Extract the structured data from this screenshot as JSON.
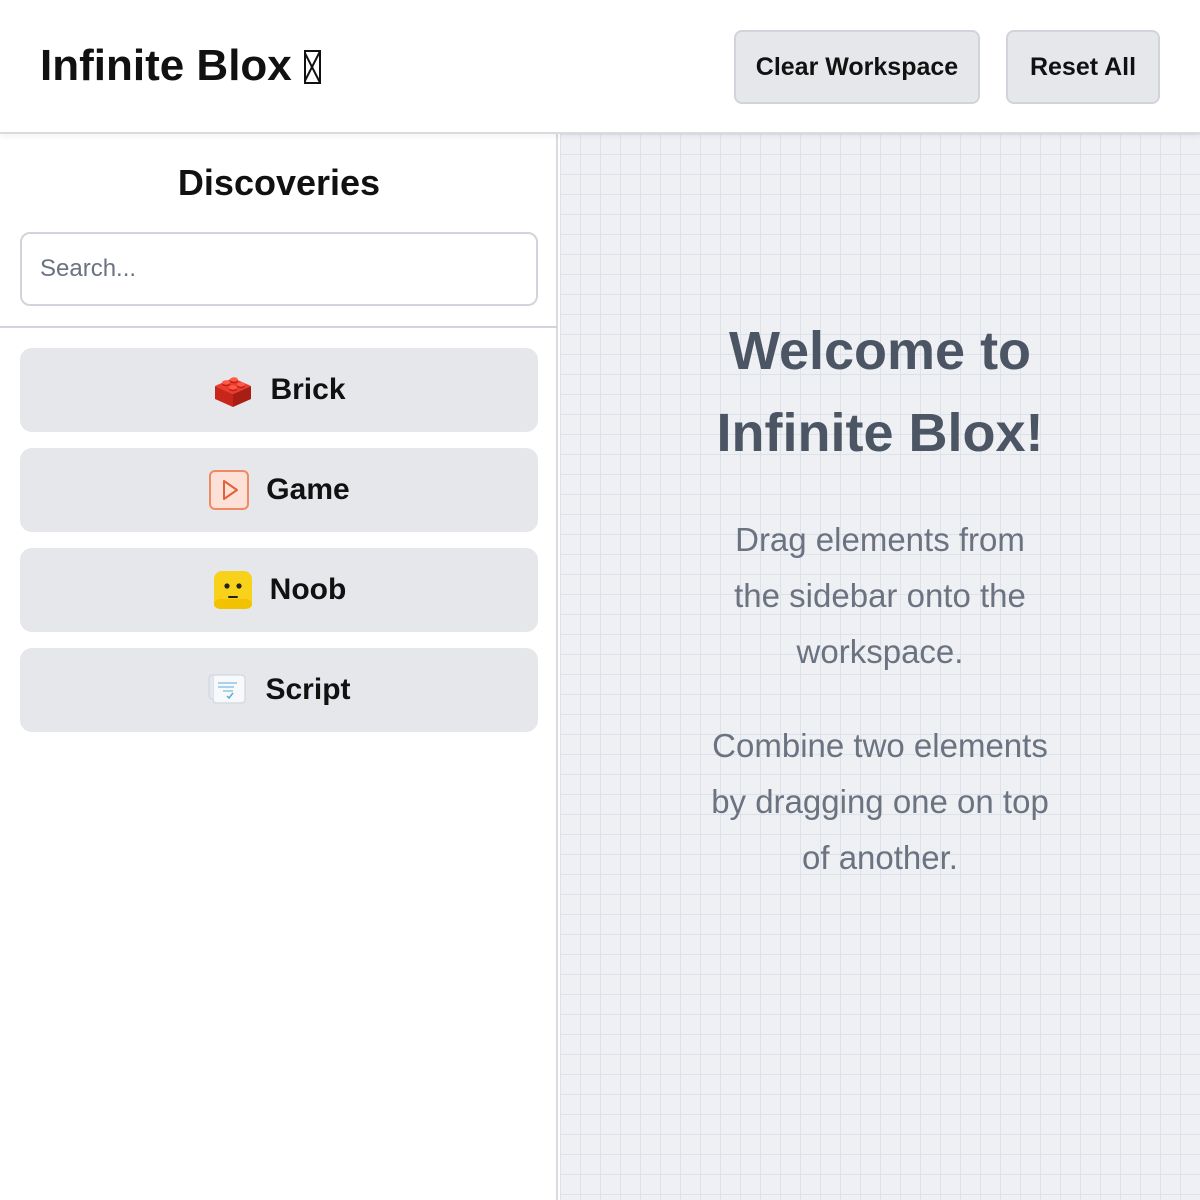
{
  "header": {
    "title": "Infinite Blox",
    "clear_label": "Clear Workspace",
    "reset_label": "Reset All"
  },
  "sidebar": {
    "heading": "Discoveries",
    "search_placeholder": "Search...",
    "search_value": "",
    "items": [
      {
        "label": "Brick",
        "icon": "lego-brick-icon"
      },
      {
        "label": "Game",
        "icon": "play-icon"
      },
      {
        "label": "Noob",
        "icon": "noob-face-icon"
      },
      {
        "label": "Script",
        "icon": "script-icon"
      }
    ]
  },
  "workspace": {
    "welcome_title": "Welcome to Infinite Blox!",
    "instruction_1": "Drag elements from the sidebar onto the workspace.",
    "instruction_2": "Combine two elements by dragging one on top of another."
  },
  "colors": {
    "button_bg": "#e5e7eb",
    "workspace_bg": "#eef0f4",
    "grid_line": "#dde2ea",
    "brick_red": "#d92b1f",
    "game_orange": "#f08a64",
    "noob_yellow": "#f8d11a"
  }
}
